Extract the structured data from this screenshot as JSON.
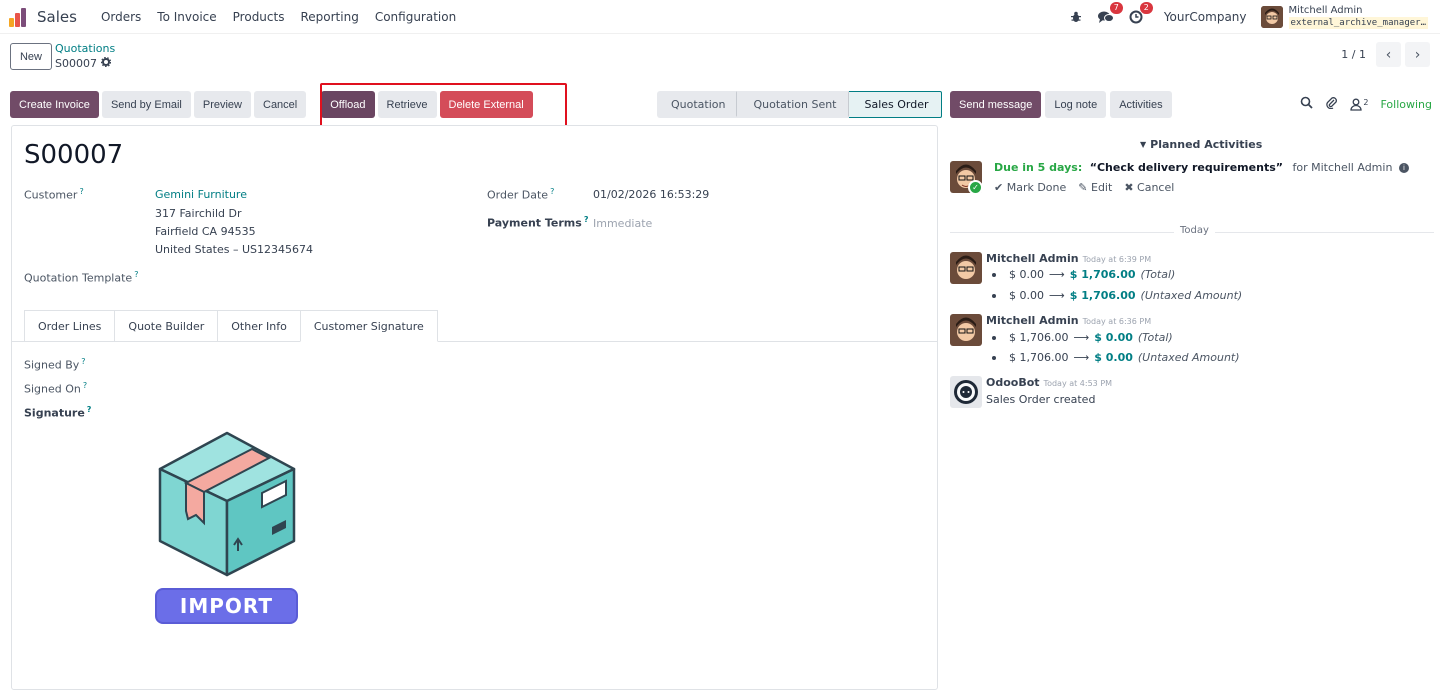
{
  "navbar": {
    "app_name": "Sales",
    "menu": [
      "Orders",
      "To Invoice",
      "Products",
      "Reporting",
      "Configuration"
    ],
    "messages_count": "7",
    "activities_count": "2",
    "company": "YourCompany",
    "user_name": "Mitchell Admin",
    "database": "external_archive_manager…"
  },
  "control_panel": {
    "new_label": "New",
    "breadcrumb_parent": "Quotations",
    "breadcrumb_current": "S00007",
    "pager_value": "1 / 1"
  },
  "actions": {
    "create_invoice": "Create Invoice",
    "send_by_email": "Send by Email",
    "preview": "Preview",
    "cancel": "Cancel",
    "offload": "Offload",
    "retrieve": "Retrieve",
    "delete_external": "Delete External"
  },
  "statusbar": {
    "stages": [
      "Quotation",
      "Quotation Sent",
      "Sales Order"
    ],
    "active_stage": "Sales Order"
  },
  "form": {
    "record_name": "S00007",
    "customer_label": "Customer",
    "customer_name": "Gemini Furniture",
    "address_line1": "317 Fairchild Dr",
    "address_line2": "Fairfield CA 94535",
    "address_line3": "United States – US12345674",
    "quotation_template_label": "Quotation Template",
    "order_date_label": "Order Date",
    "order_date_value": "01/02/2026 16:53:29",
    "payment_terms_label": "Payment Terms",
    "payment_terms_value": "Immediate",
    "tabs": [
      "Order Lines",
      "Quote Builder",
      "Other Info",
      "Customer Signature"
    ],
    "active_tab": "Customer Signature",
    "signed_by_label": "Signed By",
    "signed_on_label": "Signed On",
    "signature_label": "Signature",
    "signature_image_text": "IMPORT"
  },
  "chatter": {
    "send_message": "Send message",
    "log_note": "Log note",
    "activities": "Activities",
    "followers_count": "2",
    "following": "Following",
    "planned_activities": "Planned Activities",
    "activity": {
      "due": "Due in 5 days:",
      "summary": "“Check delivery requirements”",
      "for": "for Mitchell Admin",
      "mark_done": "Mark Done",
      "edit": "Edit",
      "cancel": "Cancel"
    },
    "today_label": "Today",
    "messages": [
      {
        "author": "Mitchell Admin",
        "date": "Today at 6:39 PM",
        "changes": [
          {
            "old": "$ 0.00",
            "new": "$ 1,706.00",
            "field": "(Total)"
          },
          {
            "old": "$ 0.00",
            "new": "$ 1,706.00",
            "field": "(Untaxed Amount)"
          }
        ]
      },
      {
        "author": "Mitchell Admin",
        "date": "Today at 6:36 PM",
        "changes": [
          {
            "old": "$ 1,706.00",
            "new": "$ 0.00",
            "field": "(Total)"
          },
          {
            "old": "$ 1,706.00",
            "new": "$ 0.00",
            "field": "(Untaxed Amount)"
          }
        ]
      },
      {
        "author": "OdooBot",
        "date": "Today at 4:53 PM",
        "body": "Sales Order created"
      }
    ]
  },
  "colors": {
    "primary": "#714b67",
    "danger": "#d44c59",
    "link": "#017e84",
    "success": "#28a745",
    "highlight": "#e0101e"
  },
  "icons": [
    "app-logo-icon",
    "bug-icon",
    "chat-icon",
    "clock-icon",
    "gear-icon",
    "search-icon",
    "paperclip-icon",
    "follower-icon",
    "info-icon",
    "check-icon",
    "pencil-icon",
    "times-icon",
    "caret-down-icon",
    "arrow-right-icon",
    "chevron-left-icon",
    "chevron-right-icon"
  ]
}
